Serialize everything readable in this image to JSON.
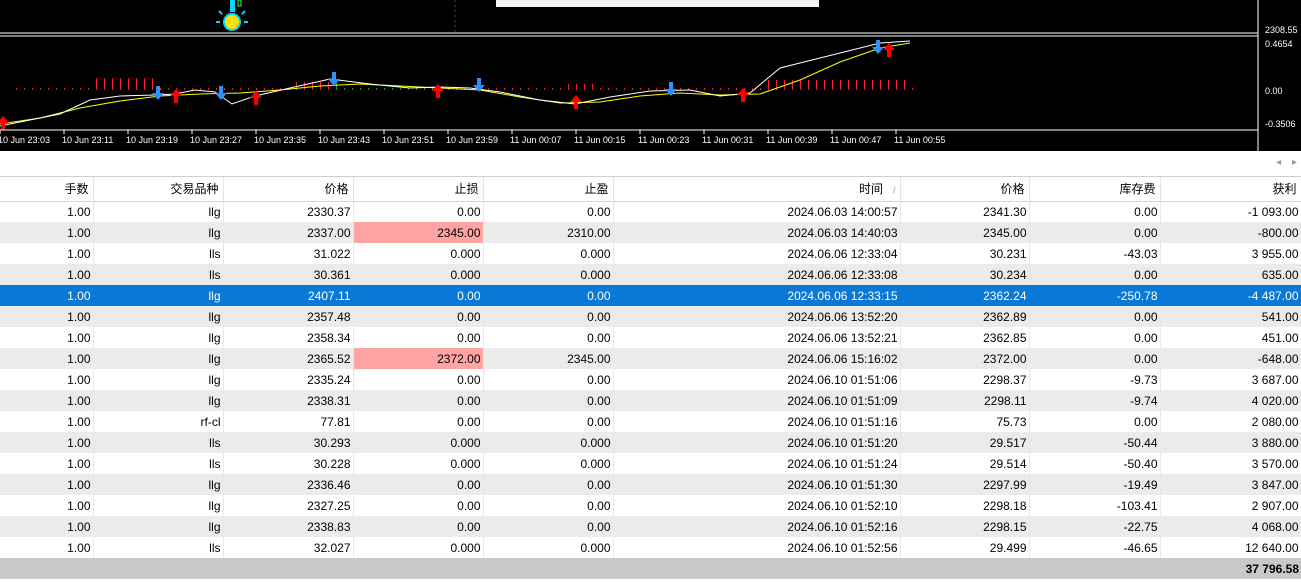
{
  "chart": {
    "price_axis_top": "2308.55",
    "indicator_axis": [
      "0.4654",
      "0.00",
      "-0.3506"
    ],
    "time_labels": [
      "10 Jun 23:03",
      "10 Jun 23:11",
      "10 Jun 23:19",
      "10 Jun 23:27",
      "10 Jun 23:35",
      "10 Jun 23:43",
      "10 Jun 23:51",
      "10 Jun 23:59",
      "11 Jun 00:07",
      "11 Jun 00:15",
      "11 Jun 00:23",
      "11 Jun 00:31",
      "11 Jun 00:39",
      "11 Jun 00:47",
      "11 Jun 00:55"
    ],
    "colors": {
      "background": "#000000",
      "fast_line": "#ffffff",
      "slow_line": "#ffff00",
      "buy_arrow": "#ff0000",
      "sell_arrow": "#2f8fff",
      "histogram": "#ff0000"
    }
  },
  "strip": {
    "left_arrow": "◂",
    "right_arrow": "▸"
  },
  "table": {
    "headers": [
      "手数",
      "交易品种",
      "价格",
      "止损",
      "止盈",
      "时间",
      "价格",
      "库存费",
      "获利"
    ],
    "sort_indicator": "/",
    "rows": [
      [
        "1.00",
        "llg",
        "2330.37",
        "0.00",
        "0.00",
        "2024.06.03 14:00:57",
        "2341.30",
        "0.00",
        "-1 093.00"
      ],
      [
        "1.00",
        "llg",
        "2337.00",
        "2345.00",
        "2310.00",
        "2024.06.03 14:40:03",
        "2345.00",
        "0.00",
        "-800.00"
      ],
      [
        "1.00",
        "lls",
        "31.022",
        "0.000",
        "0.000",
        "2024.06.06 12:33:04",
        "30.231",
        "-43.03",
        "3 955.00"
      ],
      [
        "1.00",
        "lls",
        "30.361",
        "0.000",
        "0.000",
        "2024.06.06 12:33:08",
        "30.234",
        "0.00",
        "635.00"
      ],
      [
        "1.00",
        "llg",
        "2407.11",
        "0.00",
        "0.00",
        "2024.06.06 12:33:15",
        "2362.24",
        "-250.78",
        "-4 487.00"
      ],
      [
        "1.00",
        "llg",
        "2357.48",
        "0.00",
        "0.00",
        "2024.06.06 13:52:20",
        "2362.89",
        "0.00",
        "541.00"
      ],
      [
        "1.00",
        "llg",
        "2358.34",
        "0.00",
        "0.00",
        "2024.06.06 13:52:21",
        "2362.85",
        "0.00",
        "451.00"
      ],
      [
        "1.00",
        "llg",
        "2365.52",
        "2372.00",
        "2345.00",
        "2024.06.06 15:16:02",
        "2372.00",
        "0.00",
        "-648.00"
      ],
      [
        "1.00",
        "llg",
        "2335.24",
        "0.00",
        "0.00",
        "2024.06.10 01:51:06",
        "2298.37",
        "-9.73",
        "3 687.00"
      ],
      [
        "1.00",
        "llg",
        "2338.31",
        "0.00",
        "0.00",
        "2024.06.10 01:51:09",
        "2298.11",
        "-9.74",
        "4 020.00"
      ],
      [
        "1.00",
        "rf-cl",
        "77.81",
        "0.00",
        "0.00",
        "2024.06.10 01:51:16",
        "75.73",
        "0.00",
        "2 080.00"
      ],
      [
        "1.00",
        "lls",
        "30.293",
        "0.000",
        "0.000",
        "2024.06.10 01:51:20",
        "29.517",
        "-50.44",
        "3 880.00"
      ],
      [
        "1.00",
        "lls",
        "30.228",
        "0.000",
        "0.000",
        "2024.06.10 01:51:24",
        "29.514",
        "-50.40",
        "3 570.00"
      ],
      [
        "1.00",
        "llg",
        "2336.46",
        "0.00",
        "0.00",
        "2024.06.10 01:51:30",
        "2297.99",
        "-19.49",
        "3 847.00"
      ],
      [
        "1.00",
        "llg",
        "2327.25",
        "0.00",
        "0.00",
        "2024.06.10 01:52:10",
        "2298.18",
        "-103.41",
        "2 907.00"
      ],
      [
        "1.00",
        "llg",
        "2338.83",
        "0.00",
        "0.00",
        "2024.06.10 01:52:16",
        "2298.15",
        "-22.75",
        "4 068.00"
      ],
      [
        "1.00",
        "lls",
        "32.027",
        "0.000",
        "0.000",
        "2024.06.10 01:52:56",
        "29.499",
        "-46.65",
        "12 640.00"
      ]
    ],
    "selected_row": 4,
    "sl_hit_rows": [
      1,
      7
    ],
    "total_profit": "37 796.58",
    "colors": {
      "selected": "#0a78d7",
      "stop_loss_hit": "#ffa3a3",
      "stripe": "#ebebeb",
      "total": "#c9c9c9"
    }
  }
}
